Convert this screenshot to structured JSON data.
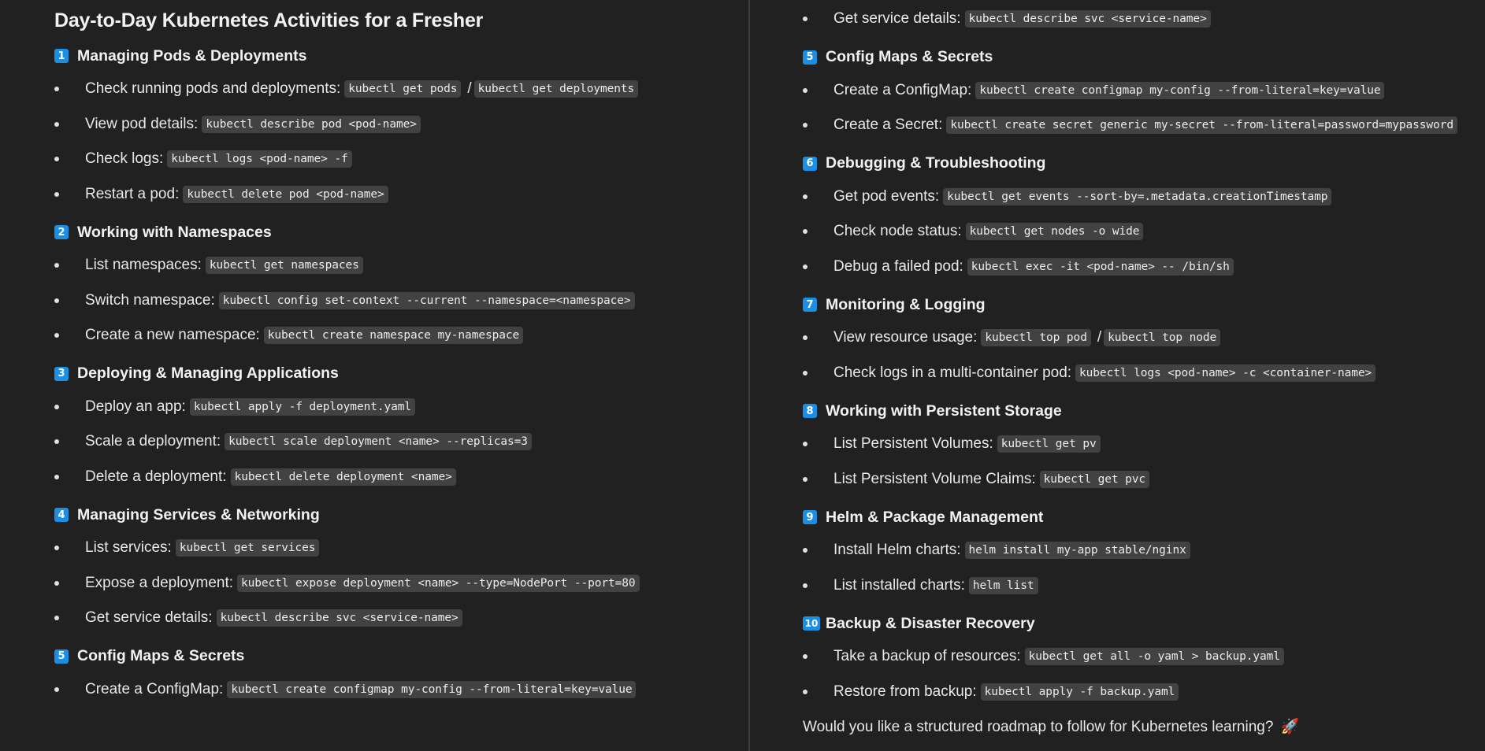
{
  "left": {
    "title": "Day-to-Day Kubernetes Activities for a Fresher",
    "sections": [
      {
        "num": "1",
        "title": "Managing Pods & Deployments",
        "items": [
          {
            "label": "Check running pods and deployments:",
            "code": "kubectl get pods",
            "sep": "/",
            "code2": "kubectl get deployments"
          },
          {
            "label": "View pod details:",
            "code": "kubectl describe pod <pod-name>"
          },
          {
            "label": "Check logs:",
            "code": "kubectl logs <pod-name> -f"
          },
          {
            "label": "Restart a pod:",
            "code": "kubectl delete pod <pod-name>"
          }
        ]
      },
      {
        "num": "2",
        "title": "Working with Namespaces",
        "items": [
          {
            "label": "List namespaces:",
            "code": "kubectl get namespaces"
          },
          {
            "label": "Switch namespace:",
            "code": "kubectl config set-context --current --namespace=<namespace>"
          },
          {
            "label": "Create a new namespace:",
            "code": "kubectl create namespace my-namespace"
          }
        ]
      },
      {
        "num": "3",
        "title": "Deploying & Managing Applications",
        "items": [
          {
            "label": "Deploy an app:",
            "code": "kubectl apply -f deployment.yaml"
          },
          {
            "label": "Scale a deployment:",
            "code": "kubectl scale deployment <name> --replicas=3"
          },
          {
            "label": "Delete a deployment:",
            "code": "kubectl delete deployment <name>"
          }
        ]
      },
      {
        "num": "4",
        "title": "Managing Services & Networking",
        "items": [
          {
            "label": "List services:",
            "code": "kubectl get services"
          },
          {
            "label": "Expose a deployment:",
            "code": "kubectl expose deployment <name> --type=NodePort --port=80"
          },
          {
            "label": "Get service details:",
            "code": "kubectl describe svc <service-name>"
          }
        ]
      },
      {
        "num": "5",
        "title": "Config Maps & Secrets",
        "items": [
          {
            "label": "Create a ConfigMap:",
            "code": "kubectl create configmap my-config --from-literal=key=value"
          }
        ]
      }
    ]
  },
  "right": {
    "top_item": {
      "label": "Get service details:",
      "code": "kubectl describe svc <service-name>"
    },
    "sections": [
      {
        "num": "5",
        "title": "Config Maps & Secrets",
        "items": [
          {
            "label": "Create a ConfigMap:",
            "code": "kubectl create configmap my-config --from-literal=key=value"
          },
          {
            "label": "Create a Secret:",
            "code": "kubectl create secret generic my-secret --from-literal=password=mypassword"
          }
        ]
      },
      {
        "num": "6",
        "title": "Debugging & Troubleshooting",
        "items": [
          {
            "label": "Get pod events:",
            "code": "kubectl get events --sort-by=.metadata.creationTimestamp"
          },
          {
            "label": "Check node status:",
            "code": "kubectl get nodes -o wide"
          },
          {
            "label": "Debug a failed pod:",
            "code": "kubectl exec -it <pod-name> -- /bin/sh"
          }
        ]
      },
      {
        "num": "7",
        "title": "Monitoring & Logging",
        "items": [
          {
            "label": "View resource usage:",
            "code": "kubectl top pod",
            "sep": "/",
            "code2": "kubectl top node"
          },
          {
            "label": "Check logs in a multi-container pod:",
            "code": "kubectl logs <pod-name> -c <container-name>"
          }
        ]
      },
      {
        "num": "8",
        "title": "Working with Persistent Storage",
        "items": [
          {
            "label": "List Persistent Volumes:",
            "code": "kubectl get pv"
          },
          {
            "label": "List Persistent Volume Claims:",
            "code": "kubectl get pvc"
          }
        ]
      },
      {
        "num": "9",
        "title": "Helm & Package Management",
        "items": [
          {
            "label": "Install Helm charts:",
            "code": "helm install my-app stable/nginx"
          },
          {
            "label": "List installed charts:",
            "code": "helm list"
          }
        ]
      },
      {
        "num": "10",
        "title": "Backup & Disaster Recovery",
        "items": [
          {
            "label": "Take a backup of resources:",
            "code": "kubectl get all -o yaml > backup.yaml"
          },
          {
            "label": "Restore from backup:",
            "code": "kubectl apply -f backup.yaml"
          }
        ]
      }
    ],
    "footer": "Would you like a structured roadmap to follow for Kubernetes learning?",
    "footer_emoji": "🚀"
  }
}
